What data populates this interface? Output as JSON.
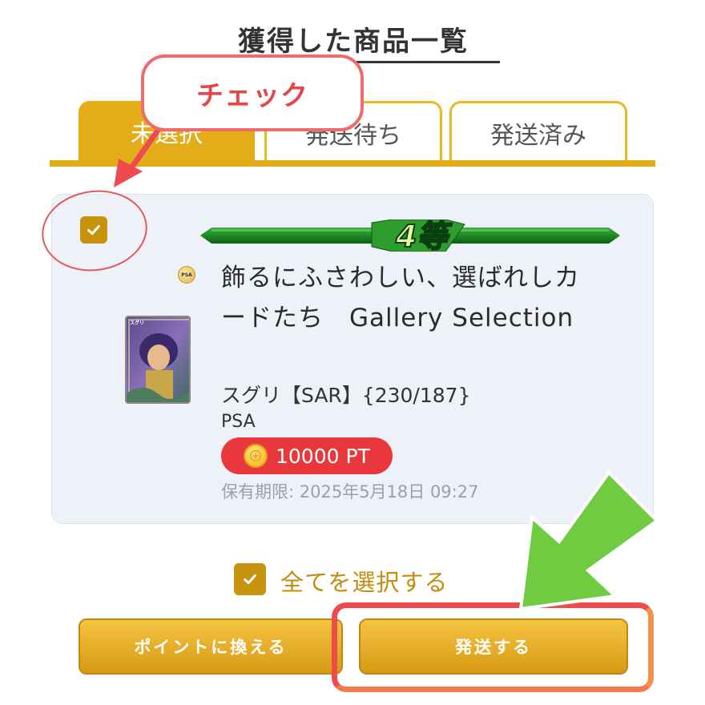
{
  "page": {
    "title": "獲得した商品一覧"
  },
  "tabs": [
    {
      "label": "未選択",
      "active": true
    },
    {
      "label": "発送待ち",
      "active": false
    },
    {
      "label": "発送済み",
      "active": false
    }
  ],
  "item": {
    "checked": true,
    "rank": "4等",
    "title": "飾るにふさわしい、選ばれしカードたち　Gallery Selection",
    "subtitle": "スグリ【SAR】{230/187}",
    "grade": "PSA",
    "badge_text": "PSA",
    "card_name": "スグリ",
    "points": "10000 PT",
    "expiry": "保有期限: 2025年5月18日 09:27"
  },
  "select_all": {
    "label": "全てを選択する",
    "checked": true
  },
  "buttons": {
    "points": "ポイントに換える",
    "ship": "発送する"
  },
  "annotation": {
    "callout": "チェック"
  },
  "colors": {
    "accent_gold": "#e3ad1a",
    "button_gold": "#d79a14",
    "points_red": "#e8383d",
    "highlight_red": "#ef4b4b",
    "arrow_green": "#6fcb3f"
  }
}
